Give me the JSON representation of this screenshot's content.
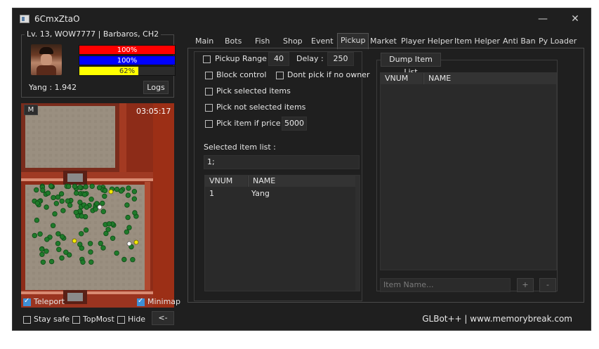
{
  "window": {
    "title": "6CmxZtaO",
    "minimize_glyph": "—",
    "close_glyph": "✕"
  },
  "status": {
    "group_title": "Lv. 13, WOW7777 | Barbaros, CH2",
    "hp_label": "100%",
    "hp_value": 1.0,
    "hp_color": "#ff0000",
    "mp_label": "100%",
    "mp_value": 1.0,
    "mp_color": "#0000ff",
    "exp_label": "62%",
    "exp_value": 0.62,
    "exp_color": "#ffff00",
    "yang_label": "Yang : 1.942",
    "logs_button": "Logs"
  },
  "minimap": {
    "mode_button": "M",
    "clock": "03:05:17",
    "teleport_label": "Teleport",
    "teleport_checked": true,
    "minimap_label": "Minimap",
    "minimap_checked": true
  },
  "bottom": {
    "stay_safe": "Stay safe",
    "topmost": "TopMost",
    "hide": "Hide",
    "collapse_button": "<-"
  },
  "tabs": [
    "Main",
    "Bots",
    "Fish",
    "Shop",
    "Event",
    "Pickup",
    "Market",
    "Player Helper",
    "Item Helper",
    "Anti Ban",
    "Py Loader"
  ],
  "active_tab": "Pickup",
  "pickup": {
    "range_label": "Pickup Range :",
    "range_value": "40",
    "delay_label": "Delay :",
    "delay_value": "250",
    "block_control": "Block control",
    "dont_pick": "Dont pick if no owner",
    "pick_selected": "Pick selected items",
    "pick_not_selected": "Pick not selected items",
    "pick_price_label": "Pick item if price >",
    "price_value": "5000",
    "selected_list_label": "Selected item list :",
    "selected_list_value": "1;",
    "table": {
      "col_vnum": "VNUM",
      "col_name": "NAME",
      "rows": [
        {
          "vnum": "1",
          "name": "Yang"
        }
      ]
    }
  },
  "dump": {
    "group_title": "Dump Item List",
    "col_vnum": "VNUM",
    "col_name": "NAME",
    "search_placeholder": "Item Name...",
    "add_button": "+",
    "remove_button": "-"
  },
  "footer": "GLBot++ | www.memorybreak.com",
  "icons": {
    "window": "app-icon",
    "portrait": "character-portrait"
  }
}
